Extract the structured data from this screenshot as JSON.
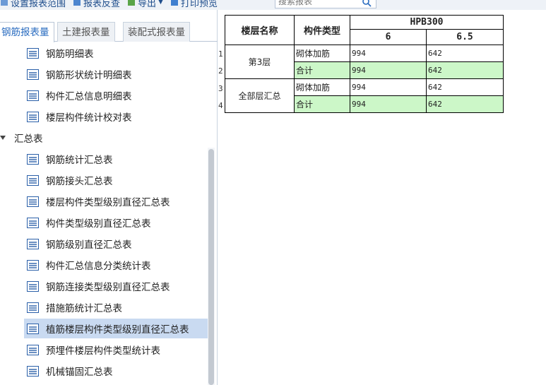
{
  "toolbar": {
    "set_range_label": "设置报表范围",
    "report_reverse_label": "报表反查",
    "export_label": "导出",
    "print_preview_label": "打印预览",
    "search_placeholder": "搜索报表"
  },
  "tabs": [
    {
      "label": "钢筋报表量",
      "active": true
    },
    {
      "label": "土建报表量",
      "active": false
    },
    {
      "label": "装配式报表量",
      "active": false
    }
  ],
  "tree": {
    "items_top": [
      {
        "label": "钢筋明细表"
      },
      {
        "label": "钢筋形状统计明细表"
      },
      {
        "label": "构件汇总信息明细表"
      },
      {
        "label": "楼层构件统计校对表"
      }
    ],
    "group_label": "汇总表",
    "items_summary": [
      {
        "label": "钢筋统计汇总表"
      },
      {
        "label": "钢筋接头汇总表"
      },
      {
        "label": "楼层构件类型级别直径汇总表"
      },
      {
        "label": "构件类型级别直径汇总表"
      },
      {
        "label": "钢筋级别直径汇总表"
      },
      {
        "label": "构件汇总信息分类统计表"
      },
      {
        "label": "钢筋连接类型级别直径汇总表"
      },
      {
        "label": "措施筋统计汇总表"
      },
      {
        "label": "植筋楼层构件类型级别直径汇总表",
        "selected": true
      },
      {
        "label": "预埋件楼层构件类型统计表"
      },
      {
        "label": "机械锚固汇总表"
      }
    ]
  },
  "report": {
    "headers": {
      "floor_name": "楼层名称",
      "component_type": "构件类型",
      "steel_grade": "HPB300",
      "diameters": [
        "6",
        "6.5"
      ]
    },
    "row_numbers": [
      "1",
      "2",
      "3",
      "4"
    ],
    "groups": [
      {
        "floor": "第3层",
        "rows": [
          {
            "type": "砌体加筋",
            "values": [
              "994",
              "642"
            ],
            "highlight": false
          },
          {
            "type": "合计",
            "values": [
              "994",
              "642"
            ],
            "highlight": true
          }
        ]
      },
      {
        "floor": "全部层汇总",
        "rows": [
          {
            "type": "砌体加筋",
            "values": [
              "994",
              "642"
            ],
            "highlight": false
          },
          {
            "type": "合计",
            "values": [
              "994",
              "642"
            ],
            "highlight": true
          }
        ]
      }
    ]
  },
  "colors": {
    "accent": "#2a6cc0",
    "selected_row": "#c9daf1",
    "total_row": "#ccf7c8"
  }
}
